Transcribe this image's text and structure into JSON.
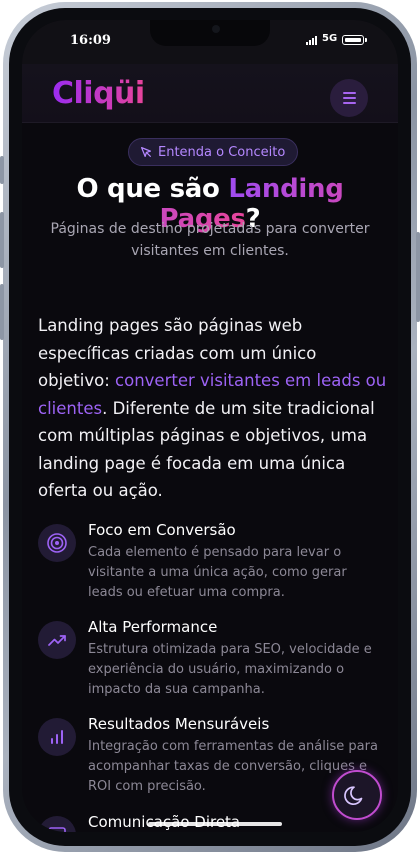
{
  "status_bar": {
    "time": "16:09",
    "network": "5G"
  },
  "header": {
    "logo": "Cliqüi"
  },
  "hero": {
    "pill_label": "Entenda o Conceito",
    "title_prefix": "O que são ",
    "title_highlight": "Landing Pages",
    "title_suffix": "?",
    "subtitle": "Páginas de destino projetadas para converter visitantes em clientes."
  },
  "intro": {
    "before": "Landing pages são páginas web específicas criadas com um único objetivo: ",
    "highlight": "converter visitantes em leads ou clientes",
    "after": ". Diferente de um site tradicional com múltiplas páginas e objetivos, uma landing page é focada em uma única oferta ou ação."
  },
  "features": [
    {
      "title": "Foco em Conversão",
      "desc": "Cada elemento é pensado para levar o visitante a uma única ação, como gerar leads ou efetuar uma compra.",
      "icon": "target-icon"
    },
    {
      "title": "Alta Performance",
      "desc": "Estrutura otimizada para SEO, velocidade e experiência do usuário, maximizando o impacto da sua campanha.",
      "icon": "trending-up-icon"
    },
    {
      "title": "Resultados Mensuráveis",
      "desc": "Integração com ferramentas de análise para acompanhar taxas de conversão, cliques e ROI com precisão.",
      "icon": "bar-chart-icon"
    },
    {
      "title": "Comunicação Direta",
      "desc": "",
      "icon": "message-icon"
    }
  ],
  "colors": {
    "accent": "#9d63f5",
    "accent_pink": "#e8459a",
    "background": "#0a090e"
  },
  "theme_toggle": {
    "icon": "moon-icon"
  }
}
